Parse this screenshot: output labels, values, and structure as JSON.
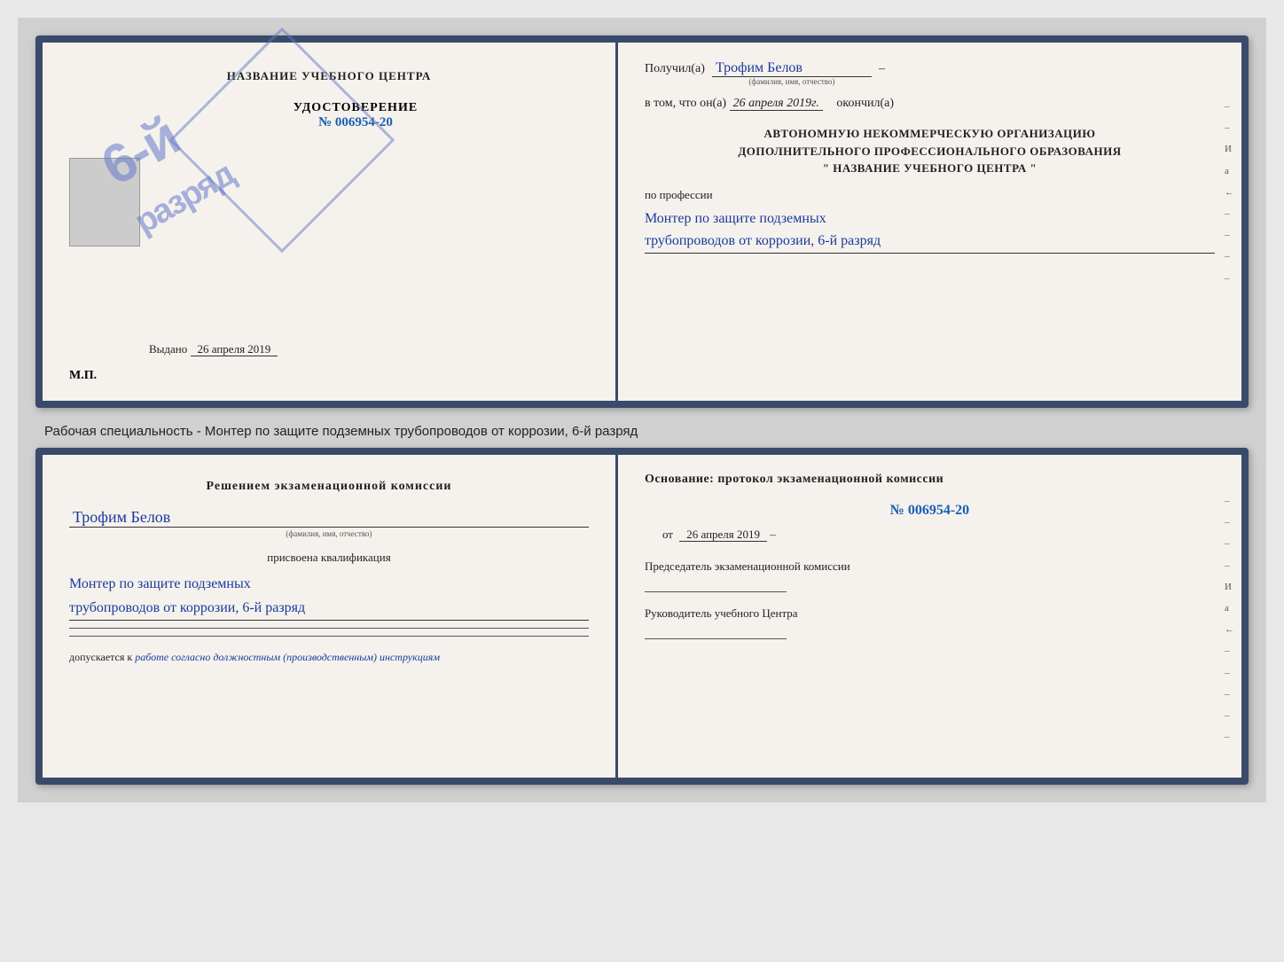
{
  "page": {
    "background": "#d0d0d0"
  },
  "top_cert": {
    "left": {
      "title": "НАЗВАНИЕ УЧЕБНОГО ЦЕНТРА",
      "cert_label": "УДОСТОВЕРЕНИЕ",
      "cert_number": "№ 006954-20",
      "stamp_line1": "6-й",
      "stamp_line2": "разряд",
      "issued_label": "Выдано",
      "issued_date": "26 апреля 2019",
      "mp_label": "М.П."
    },
    "right": {
      "received_label": "Получил(а)",
      "received_name": "Трофим Белов",
      "received_subtext": "(фамилия, имя, отчество)",
      "dash1": "–",
      "date_prefix": "в том, что он(а)",
      "date_value": "26 апреля 2019г.",
      "date_suffix": "окончил(а)",
      "org_line1": "АВТОНОМНУЮ НЕКОММЕРЧЕСКУЮ ОРГАНИЗАЦИЮ",
      "org_line2": "ДОПОЛНИТЕЛЬНОГО ПРОФЕССИОНАЛЬНОГО ОБРАЗОВАНИЯ",
      "org_line3": "\"   НАЗВАНИЕ УЧЕБНОГО ЦЕНТРА   \"",
      "profession_label": "по профессии",
      "profession_line1": "Монтер по защите подземных",
      "profession_line2": "трубопроводов от коррозии, 6-й разряд",
      "side_marks": [
        "–",
        "–",
        "И",
        "а",
        "←",
        "–",
        "–",
        "–",
        "–",
        "–"
      ]
    }
  },
  "between_text": "Рабочая специальность - Монтер по защите подземных трубопроводов от коррозии, 6-й разряд",
  "bottom_cert": {
    "left": {
      "decision_title": "Решением экзаменационной комиссии",
      "person_name": "Трофим Белов",
      "person_subtext": "(фамилия, имя, отчество)",
      "assigned_label": "присвоена квалификация",
      "qualification_line1": "Монтер по защите подземных",
      "qualification_line2": "трубопроводов от коррозии, 6-й разряд",
      "allowed_prefix": "допускается к",
      "allowed_value": "работе согласно должностным (производственным) инструкциям"
    },
    "right": {
      "basis_title": "Основание: протокол экзаменационной комиссии",
      "protocol_number": "№  006954-20",
      "protocol_date_prefix": "от",
      "protocol_date_value": "26 апреля 2019",
      "chairman_label": "Председатель экзаменационной комиссии",
      "director_label": "Руководитель учебного Центра",
      "side_marks": [
        "–",
        "–",
        "–",
        "–",
        "И",
        "а",
        "←",
        "–",
        "–",
        "–",
        "–",
        "–"
      ]
    }
  }
}
